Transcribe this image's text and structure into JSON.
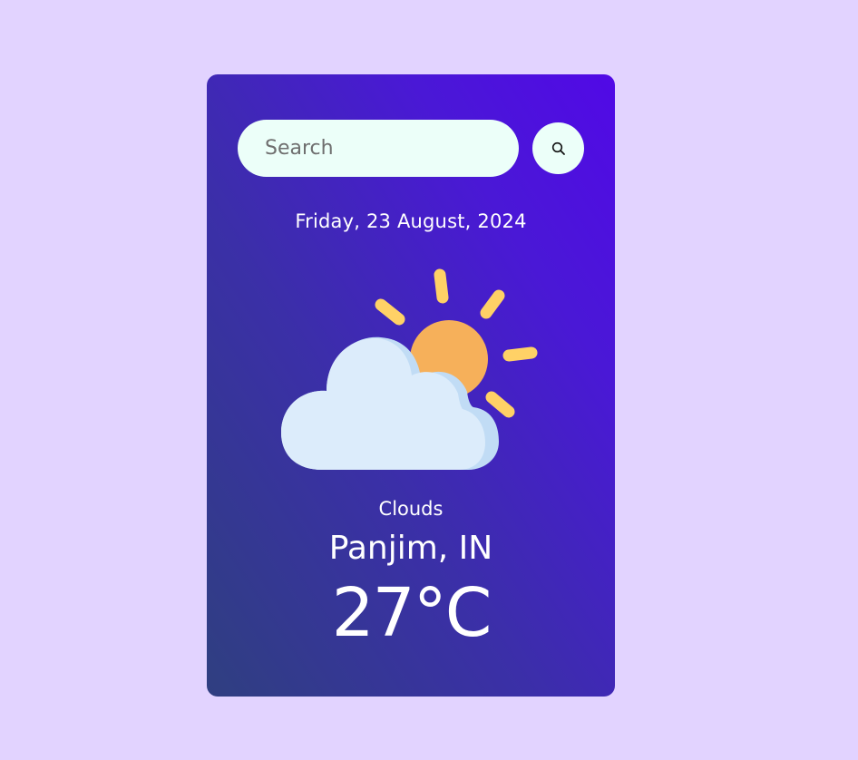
{
  "search": {
    "placeholder": "Search",
    "button_icon": "search-icon"
  },
  "weather": {
    "date": "Friday, 23 August, 2024",
    "icon": "partly-cloudy-icon",
    "condition": "Clouds",
    "location": "Panjim, IN",
    "temperature": "27°C"
  },
  "colors": {
    "background": "#e2d3ff",
    "card_gradient_start": "#2f3f80",
    "card_gradient_end": "#5109e6",
    "input_background": "#ecfff9",
    "sun": "#f6b05a",
    "sun_rays": "#ffd166",
    "cloud": "#dcecfb",
    "cloud_shadow": "#c1dcf5"
  }
}
